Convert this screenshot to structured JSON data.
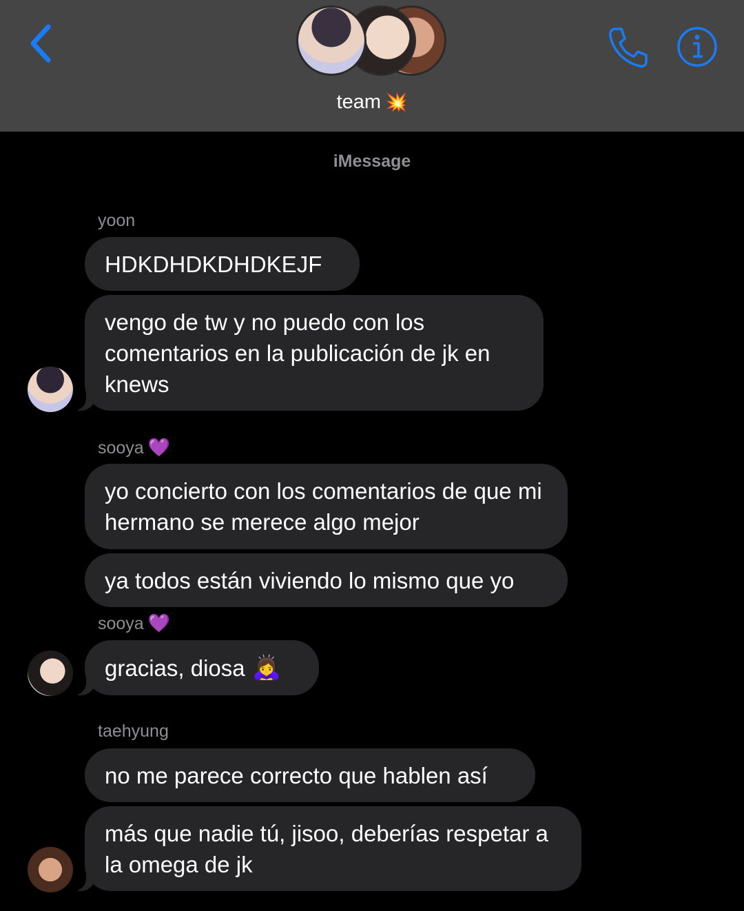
{
  "header": {
    "group_name": "team",
    "group_emoji": "💥",
    "back_icon": "chevron-left-icon",
    "call_icon": "phone-icon",
    "info_icon": "info-icon",
    "accent_color": "#1a7cf5"
  },
  "thread": {
    "service_label": "iMessage",
    "messages": [
      {
        "sender": "yoon",
        "text": "HDKDHDKDHDKEJF"
      },
      {
        "sender": "yoon",
        "text": "vengo de tw y no puedo con los comentarios en la publicación de jk en knews"
      },
      {
        "sender": "sooya",
        "sender_emoji": "💜",
        "text": "yo concierto con los comentarios de que mi hermano se merece algo mejor"
      },
      {
        "sender": "",
        "text": "ya todos están viviendo lo mismo que yo"
      },
      {
        "sender": "sooya",
        "sender_emoji": "💜",
        "text": "gracias, diosa",
        "emoji": "🙇‍♀️"
      },
      {
        "sender": "taehyung",
        "text": "no me parece correcto que hablen así"
      },
      {
        "sender": "",
        "text": "más que nadie tú, jisoo, deberías respetar a la omega de jk"
      }
    ]
  },
  "colors": {
    "header_bg": "#454545",
    "bubble_bg": "#262629",
    "sender_name": "#8e8e93",
    "heart": "#9b4ded"
  }
}
